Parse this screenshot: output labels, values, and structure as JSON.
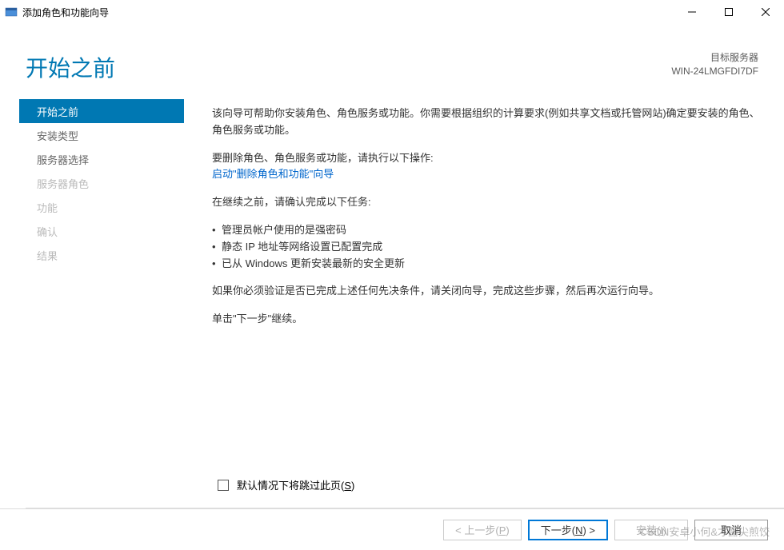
{
  "window": {
    "title": "添加角色和功能向导"
  },
  "header": {
    "page_title": "开始之前",
    "target_label": "目标服务器",
    "target_value": "WIN-24LMGFDI7DF"
  },
  "sidebar": {
    "items": [
      {
        "label": "开始之前",
        "state": "active"
      },
      {
        "label": "安装类型",
        "state": "normal"
      },
      {
        "label": "服务器选择",
        "state": "normal"
      },
      {
        "label": "服务器角色",
        "state": "disabled"
      },
      {
        "label": "功能",
        "state": "disabled"
      },
      {
        "label": "确认",
        "state": "disabled"
      },
      {
        "label": "结果",
        "state": "disabled"
      }
    ]
  },
  "content": {
    "intro": "该向导可帮助你安装角色、角色服务或功能。你需要根据组织的计算要求(例如共享文档或托管网站)确定要安装的角色、角色服务或功能。",
    "remove_line": "要删除角色、角色服务或功能，请执行以下操作:",
    "remove_link": "启动\"删除角色和功能\"向导",
    "tasks_intro": "在继续之前，请确认完成以下任务:",
    "bullets": [
      "管理员帐户使用的是强密码",
      "静态 IP 地址等网络设置已配置完成",
      "已从 Windows 更新安装最新的安全更新"
    ],
    "verify": "如果你必须验证是否已完成上述任何先决条件，请关闭向导，完成这些步骤，然后再次运行向导。",
    "continue": "单击\"下一步\"继续。",
    "skip_label_pre": "默认情况下将跳过此页(",
    "skip_hotkey": "S",
    "skip_label_post": ")"
  },
  "footer": {
    "prev_pre": "< 上一步(",
    "prev_hot": "P",
    "prev_post": ")",
    "next_pre": "下一步(",
    "next_hot": "N",
    "next_post": ") >",
    "install_pre": "安装(",
    "install_hot": "I",
    "install_post": ")",
    "cancel": "取消"
  },
  "etc": {
    "watermark": "CSDN安卓小何&才露尖煎饺"
  }
}
